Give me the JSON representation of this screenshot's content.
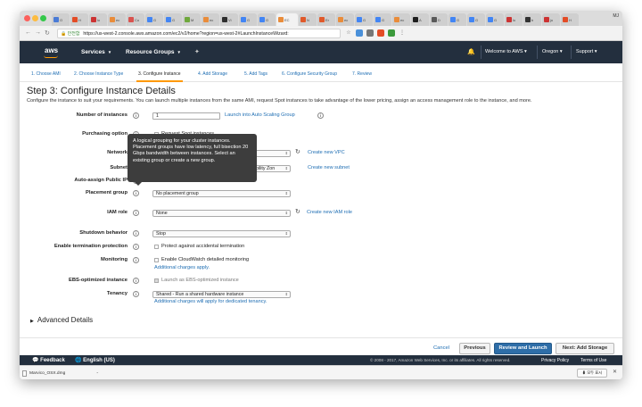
{
  "browser": {
    "tabs": [
      {
        "label": "O",
        "color": "#4a7bd6"
      },
      {
        "label": "H",
        "color": "#e34c26"
      },
      {
        "label": "lo",
        "color": "#c33"
      },
      {
        "label": "ec",
        "color": "#e98c3a"
      },
      {
        "label": "Co",
        "color": "#d9534f"
      },
      {
        "label": "G",
        "color": "#4285f4"
      },
      {
        "label": "G",
        "color": "#4285f4"
      },
      {
        "label": "M",
        "color": "#6fa83c"
      },
      {
        "label": "ec",
        "color": "#e98c3a"
      },
      {
        "label": "Vi",
        "color": "#2e2e2e"
      },
      {
        "label": "G",
        "color": "#4285f4"
      },
      {
        "label": "G",
        "color": "#4285f4"
      },
      {
        "label": "EC",
        "color": "#e98c3a",
        "active": true
      },
      {
        "label": "N",
        "color": "#e0592a"
      },
      {
        "label": "Er",
        "color": "#e0592a"
      },
      {
        "label": "ec",
        "color": "#e98c3a"
      },
      {
        "label": "G",
        "color": "#4285f4"
      },
      {
        "label": "G",
        "color": "#4285f4"
      },
      {
        "label": "ec",
        "color": "#e98c3a"
      },
      {
        "label": "A",
        "color": "#1e1e1e"
      },
      {
        "label": "D",
        "color": "#5a5a5a"
      },
      {
        "label": "G",
        "color": "#4285f4"
      },
      {
        "label": "G",
        "color": "#4285f4"
      },
      {
        "label": "G",
        "color": "#4285f4"
      },
      {
        "label": "lo",
        "color": "#c33"
      },
      {
        "label": "b",
        "color": "#333"
      },
      {
        "label": "ju",
        "color": "#c33"
      },
      {
        "label": "H",
        "color": "#e34c26"
      }
    ],
    "profile": "MJ",
    "secure_label": "🔒 안전함",
    "url": "https://us-west-2.console.aws.amazon.com/ec2/v2/home?region=us-west-2#LaunchInstanceWizard:"
  },
  "aws_header": {
    "logo": "aws",
    "services": "Services",
    "resource_groups": "Resource Groups",
    "welcome": "Welcome to AWS",
    "region": "Oregon",
    "support": "Support"
  },
  "wizard_steps": [
    "1. Choose AMI",
    "2. Choose Instance Type",
    "3. Configure Instance",
    "4. Add Storage",
    "5. Add Tags",
    "6. Configure Security Group",
    "7. Review"
  ],
  "page": {
    "title": "Step 3: Configure Instance Details",
    "description": "Configure the instance to suit your requirements. You can launch multiple instances from the same AMI, request Spot instances to take advantage of the lower pricing, assign an access management role to the instance, and more."
  },
  "form": {
    "number_of_instances": {
      "label": "Number of instances",
      "value": "1",
      "link": "Launch into Auto Scaling Group"
    },
    "purchasing_option": {
      "label": "Purchasing option",
      "value": "Request Spot instances"
    },
    "network": {
      "label": "Network",
      "link": "Create new VPC"
    },
    "subnet": {
      "label": "Subnet",
      "value": "No preference (default subnet in any Availability Zone)",
      "visible_value": "ability Zon",
      "link": "Create new subnet"
    },
    "auto_assign_ip": {
      "label": "Auto-assign Public IP"
    },
    "placement_group": {
      "label": "Placement group",
      "value": "No placement group"
    },
    "iam_role": {
      "label": "IAM role",
      "value": "None",
      "link": "Create new IAM role"
    },
    "shutdown_behavior": {
      "label": "Shutdown behavior",
      "value": "Stop"
    },
    "termination_protection": {
      "label": "Enable termination protection",
      "checkbox": "Protect against accidental termination"
    },
    "monitoring": {
      "label": "Monitoring",
      "checkbox": "Enable CloudWatch detailed monitoring",
      "note": "Additional charges apply."
    },
    "ebs_optimized": {
      "label": "EBS-optimized instance",
      "checkbox": "Launch as EBS-optimized instance"
    },
    "tenancy": {
      "label": "Tenancy",
      "value": "Shared - Run a shared hardware instance",
      "note": "Additional charges will apply for dedicated tenancy."
    }
  },
  "tooltip": "A logical grouping for your cluster instances. Placement groups have low latency, full bisection 20 Gbps bandwidth between instances. Select an existing group or create a new group.",
  "advanced_details": "Advanced Details",
  "buttons": {
    "cancel": "Cancel",
    "previous": "Previous",
    "review_launch": "Review and Launch",
    "next": "Next: Add Storage"
  },
  "aws_footer": {
    "feedback": "Feedback",
    "language": "English (US)",
    "copyright": "© 2008 - 2017, Amazon Web Services, Inc. or its affiliates. All rights reserved.",
    "privacy": "Privacy Policy",
    "terms": "Terms of Use"
  },
  "downloads": {
    "file": "Marvico_OSX.dmg",
    "show_all": "모두 표시"
  }
}
